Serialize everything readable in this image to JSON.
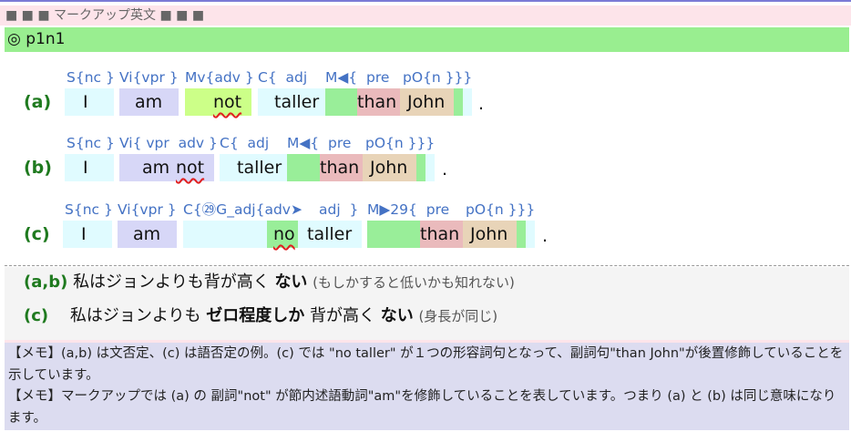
{
  "header": {
    "title": "■ ■ ■ マークアップ英文 ■ ■ ■"
  },
  "section": {
    "title": "◎ p1n1"
  },
  "rows": {
    "a": {
      "label": "(a)",
      "ann": [
        "S{nc }",
        "Vi{vpr }",
        "Mv{adv }",
        "C{  adj",
        "M◀{  pre",
        "pO{n }}}"
      ],
      "words": [
        "I",
        "am",
        "not",
        "taller",
        "than",
        "John"
      ],
      "period": "."
    },
    "b": {
      "label": "(b)",
      "ann": [
        "S{nc }",
        "Vi{ vpr  adv }",
        "C{  adj",
        "M◀{  pre",
        "pO{n }}}"
      ],
      "words": [
        "I",
        "am",
        "not",
        "taller",
        "than",
        "John"
      ],
      "period": "."
    },
    "c": {
      "label": "(c)",
      "ann": [
        "S{nc }",
        "Vi{vpr }",
        "C{㉙G_adj{adv➤",
        "adj  }",
        "M▶29{  pre",
        "pO{n }}}"
      ],
      "words": [
        "I",
        "am",
        "no",
        "taller",
        "than",
        "John"
      ],
      "period": "."
    }
  },
  "translations": {
    "ab": {
      "label": "(a,b)",
      "pre": "私はジョンよりも背が高く",
      "bold": "ない",
      "note": "(もしかすると低いかも知れない)"
    },
    "c": {
      "label": "(c)",
      "pre": "私はジョンよりも",
      "bold1": "ゼロ程度しか",
      "mid": "背が高く",
      "bold2": "ない",
      "note": "(身長が同じ)"
    }
  },
  "memo": {
    "tag1": "【メモ】",
    "line1": "(a,b) は文否定、(c) は語否定の例。(c) では \"no taller\" が１つの形容詞句となって、副詞句\"than John\"が後置修飾していることを示しています。",
    "tag2": "【メモ】",
    "line2": "マークアップでは (a) の 副詞\"not\" が節内述語動詞\"am\"を修飾していることを表しています。つまり (a) と (b) は同じ意味になります。"
  }
}
